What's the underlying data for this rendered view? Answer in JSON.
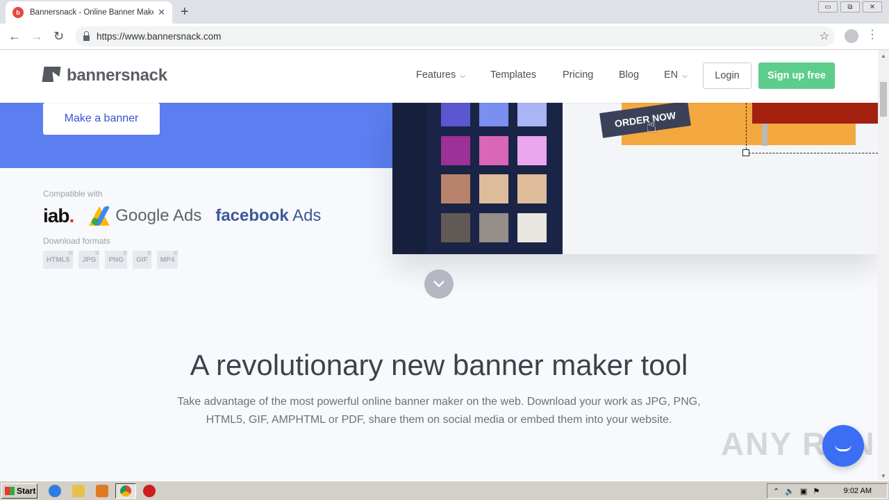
{
  "browser": {
    "tab_title": "Bannersnack - Online Banner Maker,",
    "tab_close": "✕",
    "new_tab": "+",
    "url": "https://www.bannersnack.com",
    "window_controls": [
      "▭",
      "⧉",
      "✕"
    ]
  },
  "header": {
    "logo_text": "bannersnack",
    "nav": [
      {
        "label": "Features",
        "has_dropdown": true
      },
      {
        "label": "Templates"
      },
      {
        "label": "Pricing"
      },
      {
        "label": "Blog"
      },
      {
        "label": "EN",
        "has_dropdown": true
      }
    ],
    "login_label": "Login",
    "signup_label": "Sign up free"
  },
  "hero": {
    "make_banner_label": "Make a banner",
    "order_now_label": "ORDER NOW",
    "compatible_with": "Compatible with",
    "partners": {
      "iab": "iab",
      "iab_dot": ".",
      "google_ads": "Google Ads",
      "facebook": "facebook",
      "facebook_ads": "Ads"
    },
    "download_formats_label": "Download formats",
    "formats": [
      "HTML5",
      "JPG",
      "PNG",
      "GIF",
      "MP4"
    ],
    "swatches": [
      "#5b57d0",
      "#7b8ff0",
      "#a9b5f5",
      "#9c3197",
      "#d966b7",
      "#eaa6ee",
      "#b8836a",
      "#ddbc9c",
      "#dfbd9a",
      "#625a56",
      "#968e88",
      "#e9e6e2"
    ]
  },
  "section": {
    "headline": "A revolutionary new banner maker tool",
    "subtext_line1": "Take advantage of the most powerful online banner maker on the web. Download your work as JPG, PNG,",
    "subtext_line2": "HTML5, GIF, AMPHTML or PDF, share them on social media or embed them into your website."
  },
  "watermark": "ANY RUN",
  "taskbar": {
    "start_label": "Start",
    "clock": "9:02 AM"
  },
  "colors": {
    "hero_blue": "#5b7ef0",
    "signup_green": "#5ccd8b",
    "chat_blue": "#3b6ef5"
  }
}
